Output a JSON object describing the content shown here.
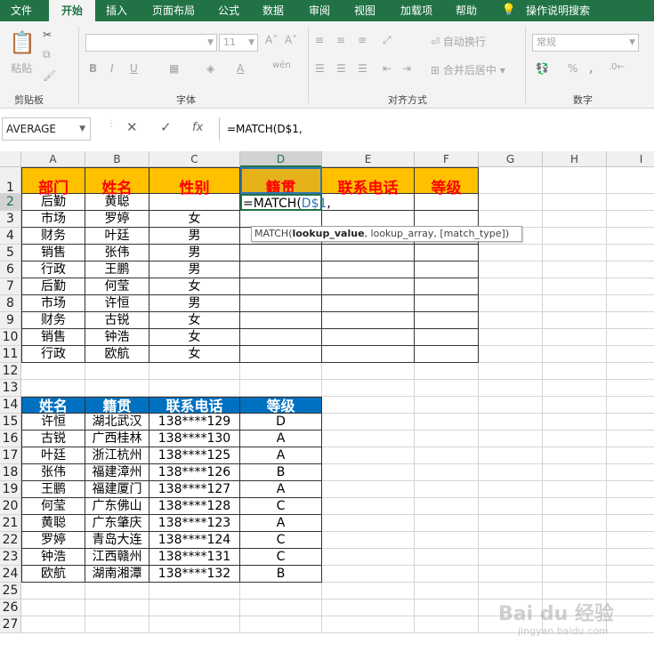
{
  "ribbon_tabs": [
    "文件",
    "开始",
    "插入",
    "页面布局",
    "公式",
    "数据",
    "审阅",
    "视图",
    "加载项",
    "帮助",
    "操作说明搜索"
  ],
  "ribbon": {
    "clipboard": {
      "paste": "粘贴",
      "group": "剪贴板"
    },
    "font": {
      "group": "字体",
      "size": "11",
      "bold": "B",
      "italic": "I",
      "underline": "U",
      "fill": "A",
      "wen": "wén"
    },
    "align": {
      "group": "对齐方式",
      "wrap": "自动换行",
      "merge": "合并后居中"
    },
    "number": {
      "group": "数字",
      "format": "常规",
      "percent": "%",
      "comma": ","
    }
  },
  "formula_bar": {
    "name_box": "AVERAGE",
    "cancel": "✕",
    "enter": "✓",
    "fx": "fx",
    "formula": "=MATCH(D$1,"
  },
  "columns": [
    "A",
    "B",
    "C",
    "D",
    "E",
    "F",
    "G",
    "H",
    "I"
  ],
  "rows": [
    "1",
    "2",
    "3",
    "4",
    "5",
    "6",
    "7",
    "8",
    "9",
    "10",
    "11",
    "12",
    "13",
    "14",
    "15",
    "16",
    "17",
    "18",
    "19",
    "20",
    "21",
    "22",
    "23",
    "24",
    "25",
    "26",
    "27"
  ],
  "table1_header": [
    "部门",
    "姓名",
    "性别",
    "籍贯",
    "联系电话",
    "等级"
  ],
  "table1": [
    [
      "后勤",
      "黄聪",
      ""
    ],
    [
      "市场",
      "罗婷",
      "女"
    ],
    [
      "财务",
      "叶廷",
      "男"
    ],
    [
      "销售",
      "张伟",
      "男"
    ],
    [
      "行政",
      "王鹏",
      "男"
    ],
    [
      "后勤",
      "何莹",
      "女"
    ],
    [
      "市场",
      "许恒",
      "男"
    ],
    [
      "财务",
      "古锐",
      "女"
    ],
    [
      "销售",
      "钟浩",
      "女"
    ],
    [
      "行政",
      "欧航",
      "女"
    ]
  ],
  "active_cell": {
    "text": "=MATCH(",
    "ref": "D$1",
    "comma": ","
  },
  "tooltip": {
    "fn": "MATCH(",
    "arg1": "lookup_value",
    "rest": ", lookup_array, [match_type])"
  },
  "table2_header": [
    "姓名",
    "籍贯",
    "联系电话",
    "等级"
  ],
  "table2": [
    [
      "许恒",
      "湖北武汉",
      "138****129",
      "D"
    ],
    [
      "古锐",
      "广西桂林",
      "138****130",
      "A"
    ],
    [
      "叶廷",
      "浙江杭州",
      "138****125",
      "A"
    ],
    [
      "张伟",
      "福建漳州",
      "138****126",
      "B"
    ],
    [
      "王鹏",
      "福建厦门",
      "138****127",
      "A"
    ],
    [
      "何莹",
      "广东佛山",
      "138****128",
      "C"
    ],
    [
      "黄聪",
      "广东肇庆",
      "138****123",
      "A"
    ],
    [
      "罗婷",
      "青岛大连",
      "138****124",
      "C"
    ],
    [
      "钟浩",
      "江西赣州",
      "138****131",
      "C"
    ],
    [
      "欧航",
      "湖南湘潭",
      "138****132",
      "B"
    ]
  ],
  "watermark": {
    "brand": "Bai du 经验",
    "url": "jingyan.baidu.com"
  },
  "colors": {
    "excel_green": "#217346",
    "header_orange": "#ffc000",
    "header_red": "#ff0000",
    "blue_header": "#0070c0"
  }
}
